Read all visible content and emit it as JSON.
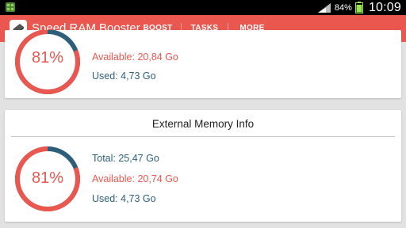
{
  "status_bar": {
    "battery_percent": "84%",
    "clock": "10:09"
  },
  "action_bar": {
    "title": "Speed RAM Booster",
    "tabs": [
      {
        "label": "BOOST",
        "selected": false
      },
      {
        "label": "TASKS",
        "selected": false
      },
      {
        "label": "MORE",
        "selected": true
      }
    ]
  },
  "ram_card": {
    "usage_percent": 0.81,
    "percent_label": "81%",
    "available": "Available: 20,84 Go",
    "used": "Used: 4,73 Go"
  },
  "external_card": {
    "title": "External Memory Info",
    "usage_percent": 0.81,
    "percent_label": "81%",
    "total": "Total: 25,47 Go",
    "available": "Available: 20,74 Go",
    "used": "Used: 4,73 Go"
  },
  "colors": {
    "accent": "#e9574f",
    "tab_indicator": "#3aa0d8",
    "gauge_free": "#2e5f7a",
    "text_blue": "#2e5f7a"
  },
  "icons": {
    "notification": "android-bugdroid-icon",
    "signal": "signal-strength-icon",
    "battery": "battery-icon",
    "app": "ram-chip-icon"
  }
}
